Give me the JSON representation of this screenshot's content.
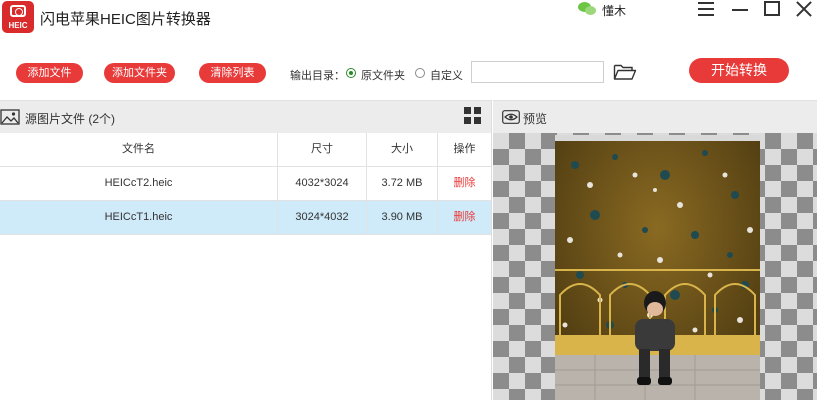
{
  "app": {
    "title": "闪电苹果HEIC图片转换器",
    "logo_text": "HEIC",
    "user_name": "懂木"
  },
  "toolbar": {
    "add_file": "添加文件",
    "add_folder": "添加文件夹",
    "clear_list": "清除列表",
    "output_label": "输出目录：",
    "radio_original": "原文件夹",
    "radio_custom": "自定义",
    "output_path": "",
    "start_button": "开始转换"
  },
  "file_panel": {
    "title": "源图片文件 (2个)",
    "columns": [
      "文件名",
      "尺寸",
      "大小",
      "操作"
    ],
    "rows": [
      {
        "name": "HEICcT2.heic",
        "dimensions": "4032*3024",
        "size": "3.72 MB",
        "action": "删除"
      },
      {
        "name": "HEICcT1.heic",
        "dimensions": "3024*4032",
        "size": "3.90 MB",
        "action": "删除"
      }
    ]
  },
  "preview_panel": {
    "title": "预览"
  },
  "icons": {
    "logo": "camera-logo-icon",
    "user": "wechat-avatar-icon",
    "menu": "hamburger-menu-icon",
    "minimize": "minimize-icon",
    "maximize": "maximize-icon",
    "close": "close-icon",
    "folder": "open-folder-icon",
    "image": "image-icon",
    "grid": "grid-view-icon",
    "eye": "eye-icon"
  },
  "colors": {
    "accent": "#e93a3a",
    "selected_row": "#cfeaf8",
    "radio_checked": "#2a8a2a"
  }
}
